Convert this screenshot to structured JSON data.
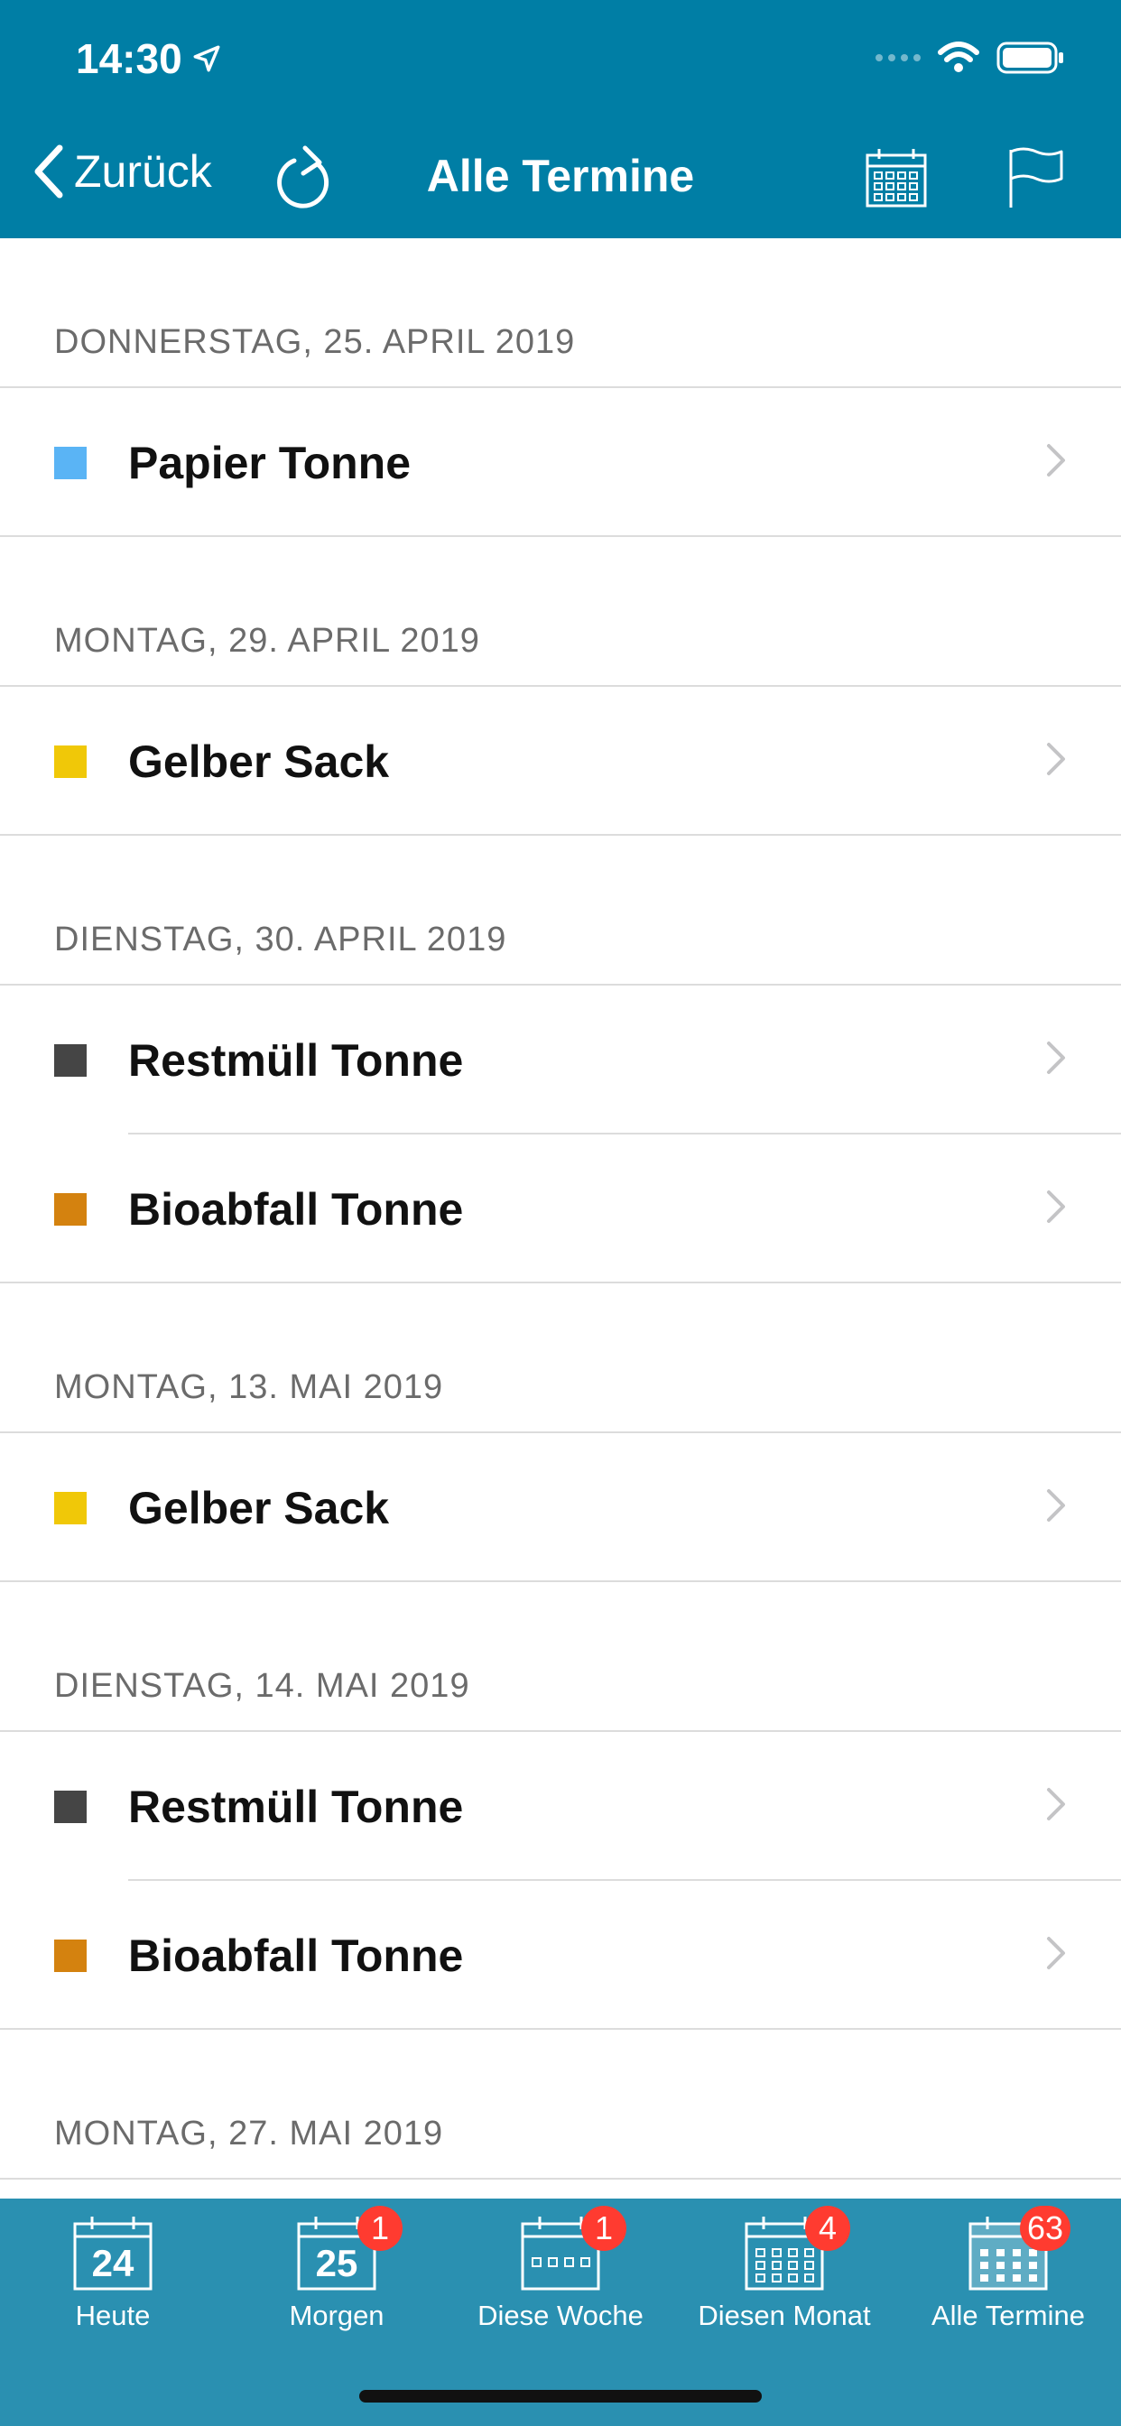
{
  "status": {
    "time": "14:30"
  },
  "nav": {
    "back_label": "Zurück",
    "title": "Alle Termine"
  },
  "sections": [
    {
      "date": "DONNERSTAG, 25. APRIL 2019",
      "items": [
        {
          "label": "Papier Tonne",
          "color": "#5ab4f5"
        }
      ]
    },
    {
      "date": "MONTAG, 29. APRIL 2019",
      "items": [
        {
          "label": "Gelber Sack",
          "color": "#f0c808"
        }
      ]
    },
    {
      "date": "DIENSTAG, 30. APRIL 2019",
      "items": [
        {
          "label": "Restmüll Tonne",
          "color": "#454545"
        },
        {
          "label": "Bioabfall Tonne",
          "color": "#d4820f"
        }
      ]
    },
    {
      "date": "MONTAG, 13. MAI 2019",
      "items": [
        {
          "label": "Gelber Sack",
          "color": "#f0c808"
        }
      ]
    },
    {
      "date": "DIENSTAG, 14. MAI 2019",
      "items": [
        {
          "label": "Restmüll Tonne",
          "color": "#454545"
        },
        {
          "label": "Bioabfall Tonne",
          "color": "#d4820f"
        }
      ]
    },
    {
      "date": "MONTAG, 27. MAI 2019",
      "items": []
    }
  ],
  "tabs": [
    {
      "label": "Heute",
      "icon": "calendar-day-icon",
      "day": "24",
      "badge": ""
    },
    {
      "label": "Morgen",
      "icon": "calendar-day-icon",
      "day": "25",
      "badge": "1"
    },
    {
      "label": "Diese Woche",
      "icon": "calendar-week-icon",
      "day": "",
      "badge": "1"
    },
    {
      "label": "Diesen Monat",
      "icon": "calendar-month-icon",
      "day": "",
      "badge": "4"
    },
    {
      "label": "Alle Termine",
      "icon": "calendar-all-icon",
      "day": "",
      "badge": "63"
    }
  ],
  "colors": {
    "header": "#007ea5",
    "tabbar": "#2a90b1",
    "badge": "#ff3b30"
  }
}
